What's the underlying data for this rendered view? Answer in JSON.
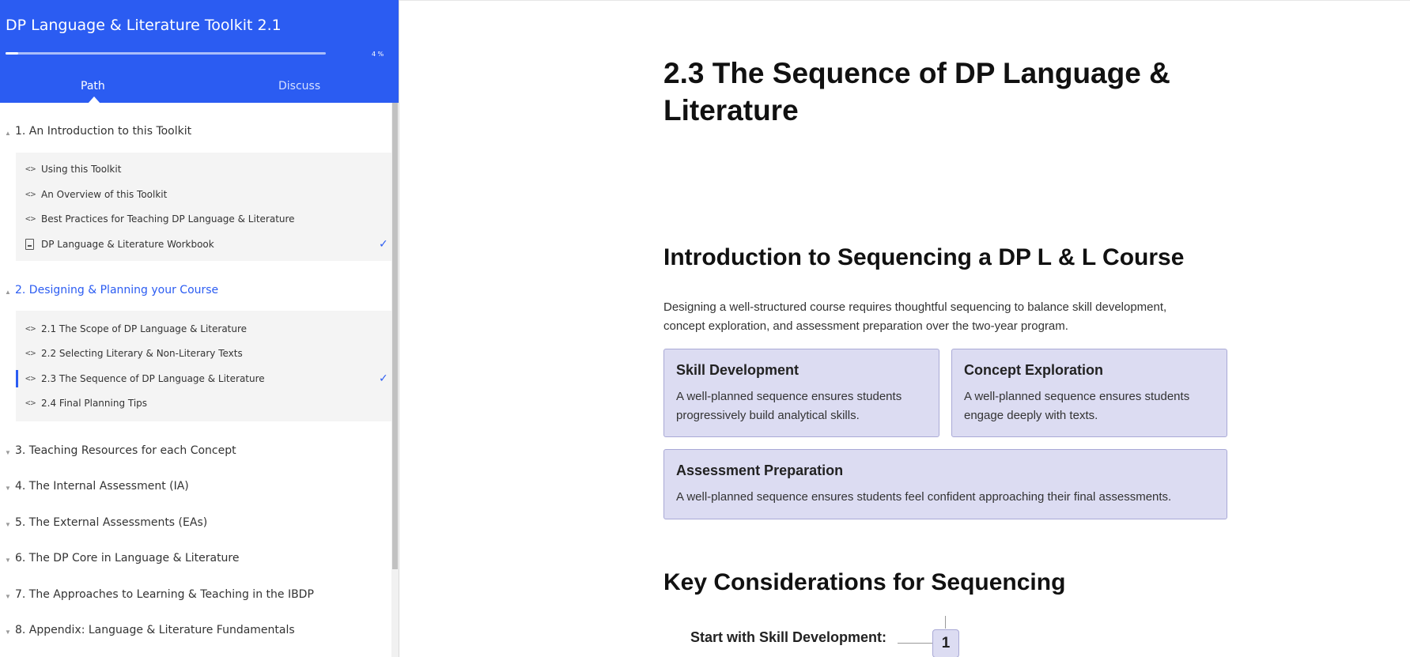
{
  "sidebar": {
    "title": "DP Language & Literature Toolkit 2.1",
    "progress": {
      "percent": 4,
      "label": "4 %"
    },
    "tabs": {
      "path": "Path",
      "discuss": "Discuss"
    },
    "sections": [
      {
        "title": "1. An Introduction to this Toolkit",
        "expanded": true,
        "items": [
          {
            "label": "Using this Toolkit",
            "icon": "code-icon",
            "completed": false
          },
          {
            "label": "An Overview of this Toolkit",
            "icon": "code-icon",
            "completed": false
          },
          {
            "label": "Best Practices for Teaching DP Language & Literature",
            "icon": "code-icon",
            "completed": false
          },
          {
            "label": "DP Language & Literature Workbook",
            "icon": "pdf-icon",
            "completed": true
          }
        ]
      },
      {
        "title": "2. Designing & Planning your Course",
        "expanded": true,
        "active": true,
        "items": [
          {
            "label": "2.1 The Scope of DP Language & Literature",
            "icon": "code-icon",
            "completed": false
          },
          {
            "label": "2.2 Selecting Literary & Non-Literary Texts",
            "icon": "code-icon",
            "completed": false
          },
          {
            "label": "2.3 The Sequence of DP Language & Literature",
            "icon": "code-icon",
            "completed": true,
            "current": true
          },
          {
            "label": "2.4 Final Planning Tips",
            "icon": "code-icon",
            "completed": false
          }
        ]
      },
      {
        "title": "3. Teaching Resources for each Concept",
        "expanded": false
      },
      {
        "title": "4. The Internal Assessment (IA)",
        "expanded": false
      },
      {
        "title": "5. The External Assessments (EAs)",
        "expanded": false
      },
      {
        "title": "6. The DP Core in Language & Literature",
        "expanded": false
      },
      {
        "title": "7. The Approaches to Learning & Teaching in the IBDP",
        "expanded": false
      },
      {
        "title": "8. Appendix: Language & Literature Fundamentals",
        "expanded": false
      }
    ]
  },
  "main": {
    "title": "2.3 The Sequence of DP Language & Literature",
    "intro_heading": "Introduction to Sequencing a DP L & L Course",
    "intro_text": "Designing a well-structured course requires thoughtful sequencing to balance skill development, concept exploration, and assessment preparation over the two-year program.",
    "cards": [
      {
        "title": "Skill Development",
        "body": "A well-planned sequence ensures students progressively build analytical skills."
      },
      {
        "title": "Concept Exploration",
        "body": "A well-planned sequence ensures students engage deeply with texts."
      },
      {
        "title": "Assessment Preparation",
        "body": "A well-planned sequence ensures students feel confident approaching their final assessments."
      }
    ],
    "key_heading": "Key Considerations for Sequencing",
    "steps": [
      {
        "number": "1",
        "label": "Start with Skill Development:"
      }
    ]
  },
  "icons": {
    "code": "<>",
    "check": "✓",
    "tri_open": "▲",
    "tri_closed": "▼"
  },
  "colors": {
    "accent": "#2b5cf2",
    "card_bg": "#dcdcf2",
    "card_border": "#a9a9d6"
  }
}
